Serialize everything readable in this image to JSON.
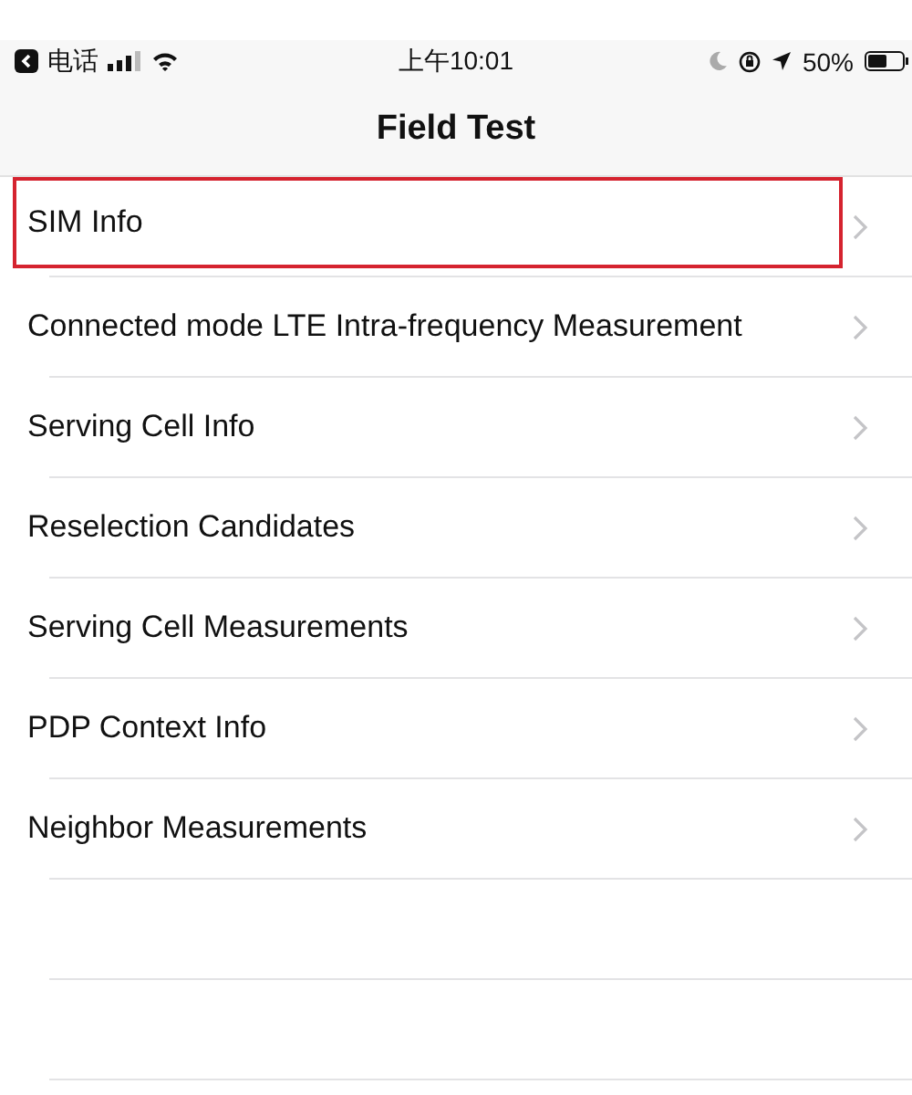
{
  "status_bar": {
    "back_app": "电话",
    "time": "上午10:01",
    "battery": "50%"
  },
  "nav_bar": {
    "title": "Field Test"
  },
  "items": [
    {
      "label": "SIM Info",
      "highlighted": true
    },
    {
      "label": "Connected mode LTE Intra-frequency Measurement",
      "highlighted": false
    },
    {
      "label": "Serving Cell Info",
      "highlighted": false
    },
    {
      "label": "Reselection Candidates",
      "highlighted": false
    },
    {
      "label": "Serving Cell Measurements",
      "highlighted": false
    },
    {
      "label": "PDP Context Info",
      "highlighted": false
    },
    {
      "label": "Neighbor Measurements",
      "highlighted": false
    }
  ]
}
